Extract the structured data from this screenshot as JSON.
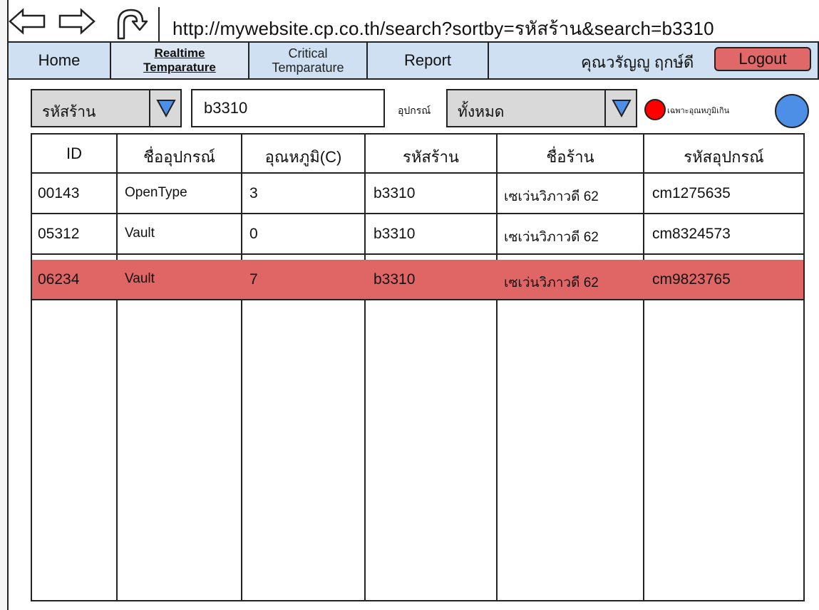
{
  "browser": {
    "url": "http://mywebsite.cp.co.th/search?sortby=รหัสร้าน&search=b3310",
    "back_icon": "back-arrow-icon",
    "forward_icon": "forward-arrow-icon",
    "refresh_icon": "refresh-icon"
  },
  "nav": {
    "home": "Home",
    "realtime_line1": "Realtime",
    "realtime_line2": "Temparature",
    "critical_line1": "Critical",
    "critical_line2": "Temparature",
    "report": "Report",
    "user_name": "คุณวรัญญู ฤกษ์ดี",
    "logout": "Logout"
  },
  "filters": {
    "search_by_value": "รหัสร้าน",
    "search_text": "b3310",
    "device_label": "อุปกรณ์",
    "device_value": "ทั้งหมด",
    "over_temp_label": "เฉพาะอุณหภูมิเกิน"
  },
  "table": {
    "headers": [
      "ID",
      "ชื่ออุปกรณ์",
      "อุณหภูมิ(C)",
      "รหัสร้าน",
      "ชื่อร้าน",
      "รหัสอุปกรณ์"
    ],
    "rows": [
      {
        "id": "00143",
        "device": "OpenType",
        "temp": "3",
        "store_code": "b3310",
        "store_name": "เซเว่นวิภาวดี 62",
        "device_code": "cm1275635",
        "alert": false
      },
      {
        "id": "05312",
        "device": "Vault",
        "temp": "0",
        "store_code": "b3310",
        "store_name": "เซเว่นวิภาวดี 62",
        "device_code": "cm8324573",
        "alert": false
      },
      {
        "id": "06234",
        "device": "Vault",
        "temp": "7",
        "store_code": "b3310",
        "store_name": "เซเว่นวิภาวดี 62",
        "device_code": "cm9823765",
        "alert": true
      }
    ]
  },
  "colors": {
    "nav_bg": "#cfe0f2",
    "alert_row": "#e06666",
    "logout_bg": "#e06868",
    "toggle_blue": "#4d8fe6",
    "indicator_red": "#ff0000"
  }
}
